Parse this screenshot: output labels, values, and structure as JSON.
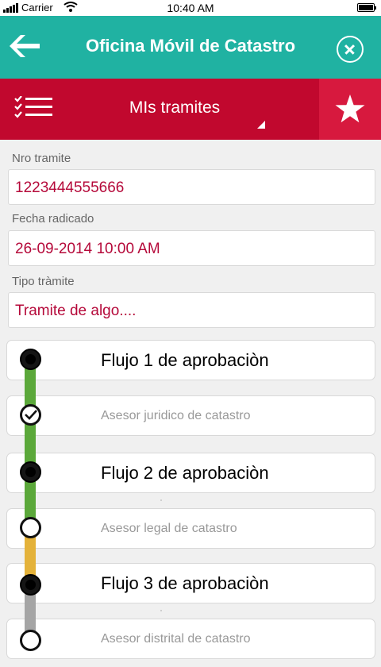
{
  "status": {
    "carrier": "Carrier",
    "time": "10:40 AM"
  },
  "header": {
    "title": "Oficina Móvil de Catastro"
  },
  "subheader": {
    "dropdown_label": "MIs tramites"
  },
  "form": {
    "nro_label": "Nro tramite",
    "nro_value": "1223444555666",
    "fecha_label": "Fecha radicado",
    "fecha_value": "26-09-2014 10:00 AM",
    "tipo_label": "Tipo tràmite",
    "tipo_value": "Tramite de algo...."
  },
  "flow": {
    "items": [
      {
        "label": "Flujo 1 de aprobaciòn"
      },
      {
        "label": "Asesor juridico de catastro"
      },
      {
        "label": "Flujo 2 de aprobaciòn"
      },
      {
        "label": "Asesor legal de catastro"
      },
      {
        "label": "Flujo 3 de aprobaciòn"
      },
      {
        "label": "Asesor distrital de catastro"
      }
    ]
  },
  "colors": {
    "header": "#20b2a2",
    "subheader": "#c1082e",
    "accent_text": "#b5093a",
    "rail_done": "#5ba83a",
    "rail_current": "#e4b23a",
    "rail_pending": "#a5a5a5"
  },
  "icons": {
    "back": "arrow-left-icon",
    "close": "close-circle-icon",
    "list": "checklist-icon",
    "favorite": "star-icon"
  }
}
